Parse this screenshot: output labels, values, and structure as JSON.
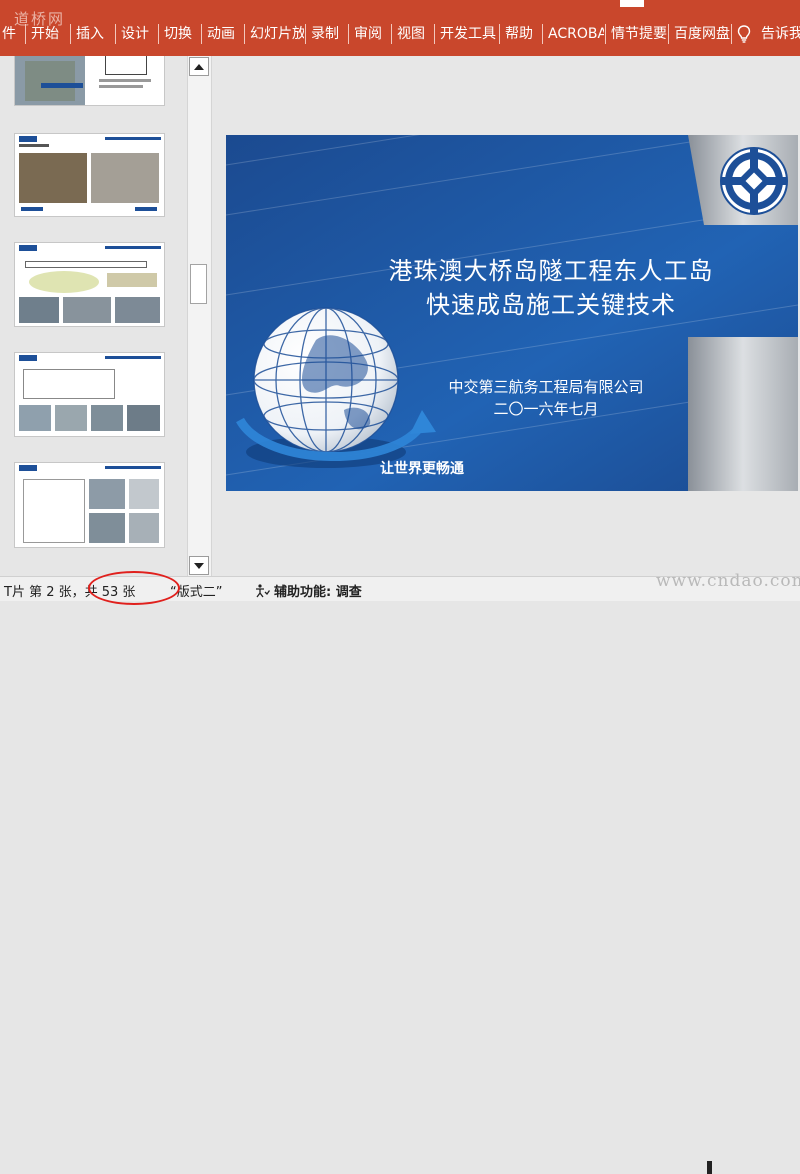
{
  "ribbon": {
    "watermark": "道桥网",
    "tabs": [
      "件",
      "开始",
      "插入",
      "设计",
      "切换",
      "动画",
      "幻灯片放",
      "录制",
      "审阅",
      "视图",
      "开发工具",
      "帮助",
      "ACROBAT",
      "情节提要",
      "百度网盘"
    ],
    "tell_me": "告诉我",
    "background_color": "#c9472c"
  },
  "slide": {
    "title_line1": "港珠澳大桥岛隧工程东人工岛",
    "title_line2": "快速成岛施工关键技术",
    "company": "中交第三航务工程局有限公司",
    "date": "二〇一六年七月",
    "slogan": "让世界更畅通",
    "background_color": "#1d4f98",
    "logo": "cccc-logo"
  },
  "thumbnails": {
    "items": [
      {
        "header_color": "#ffffff",
        "content": "slide-thumbnail-1"
      },
      {
        "header_color": "#1d4f98",
        "content": "slide-thumbnail-2"
      },
      {
        "header_color": "#1d4f98",
        "content": "slide-thumbnail-3"
      },
      {
        "header_color": "#1d4f98",
        "content": "slide-thumbnail-4"
      },
      {
        "header_color": "#1d4f98",
        "content": "slide-thumbnail-5"
      }
    ]
  },
  "status": {
    "slide_info": "T片 第 2 张，共 53 张",
    "layout": "“版式二”",
    "accessibility": "辅助功能: 调查",
    "watermark": "www.cndao.com",
    "highlight_color": "#e0201d"
  }
}
